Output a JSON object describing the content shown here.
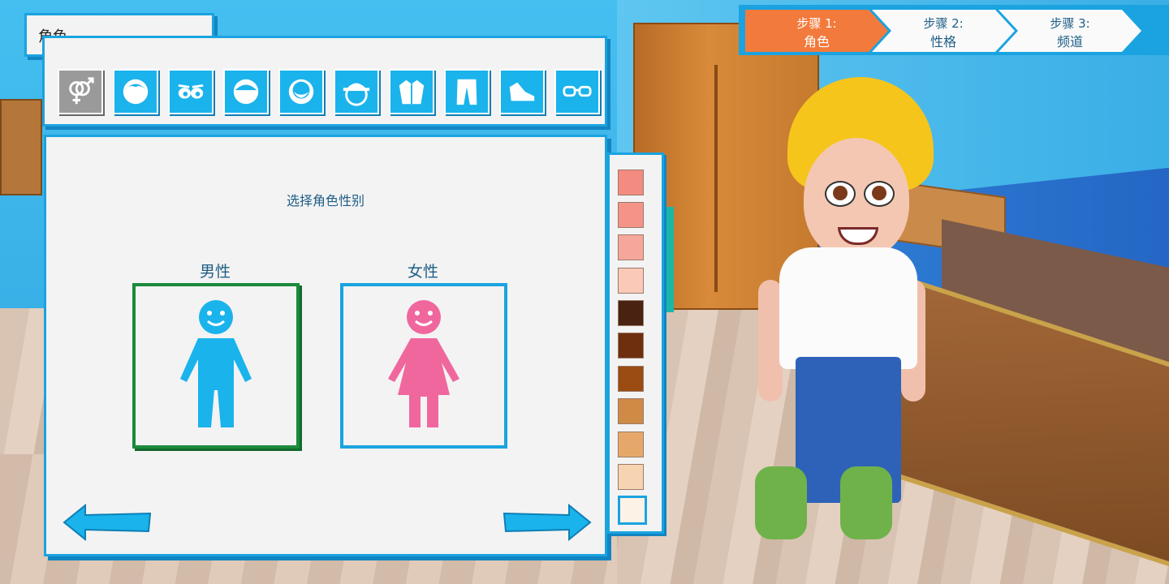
{
  "title": "角色",
  "steps": [
    {
      "line1": "步骤 1:",
      "line2": "角色",
      "active": true
    },
    {
      "line1": "步骤 2:",
      "line2": "性格",
      "active": false
    },
    {
      "line1": "步骤 3:",
      "line2": "频道",
      "active": false
    }
  ],
  "toolbar": {
    "items": [
      {
        "icon": "gender-icon",
        "active": true
      },
      {
        "icon": "head-shape-icon",
        "active": false
      },
      {
        "icon": "eyes-icon",
        "active": false
      },
      {
        "icon": "mouth-icon",
        "active": false
      },
      {
        "icon": "beard-icon",
        "active": false
      },
      {
        "icon": "hat-icon",
        "active": false
      },
      {
        "icon": "shirt-icon",
        "active": false
      },
      {
        "icon": "pants-icon",
        "active": false
      },
      {
        "icon": "shoes-icon",
        "active": false
      },
      {
        "icon": "glasses-icon",
        "active": false
      }
    ]
  },
  "panel": {
    "prompt": "选择角色性别",
    "options": [
      {
        "label": "男性",
        "selected": true,
        "color": "#1ab3ec"
      },
      {
        "label": "女性",
        "selected": false,
        "color": "#f0679e"
      }
    ]
  },
  "skin_tones": {
    "colors": [
      "#f38b80",
      "#f49488",
      "#f6a79b",
      "#fac9b8",
      "#4a2212",
      "#6e2f0f",
      "#9a4c12",
      "#cf8a46",
      "#e6a86a",
      "#f7d4b1",
      "#fdf2e6"
    ],
    "selected_index": 10
  },
  "colors": {
    "ui_blue": "#1aa3e0",
    "active_step": "#f27a3c",
    "selected_green": "#1a8a3a"
  }
}
